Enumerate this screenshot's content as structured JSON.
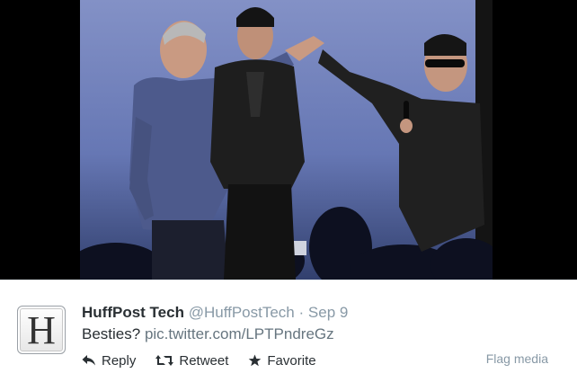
{
  "media": {
    "alt_icon": "photo",
    "background_color": "#000000",
    "stage_color": "#6b7eb8"
  },
  "tweet": {
    "avatar_letter": "H",
    "author_name": "HuffPost Tech",
    "author_handle": "@HuffPostTech",
    "separator": "·",
    "date": "Sep 9",
    "text": "Besties?",
    "link": "pic.twitter.com/LPTPndreGz"
  },
  "actions": {
    "reply_label": "Reply",
    "retweet_label": "Retweet",
    "favorite_label": "Favorite",
    "flag_label": "Flag media"
  },
  "colors": {
    "text": "#292f33",
    "muted": "#8899a6",
    "link": "#66757f"
  }
}
